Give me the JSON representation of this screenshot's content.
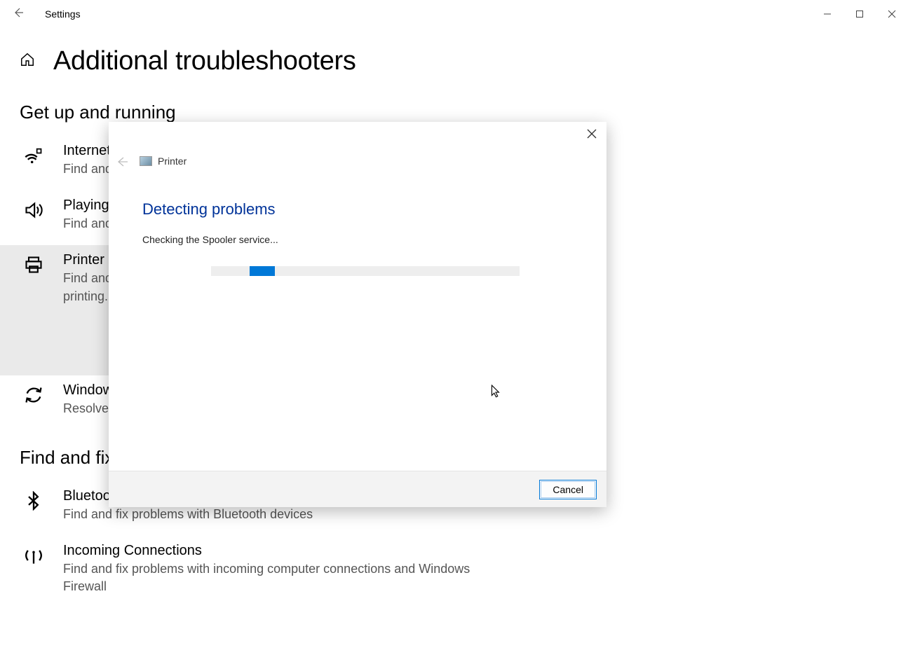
{
  "window": {
    "app_title": "Settings"
  },
  "page": {
    "title": "Additional troubleshooters"
  },
  "sections": {
    "getup": {
      "heading": "Get up and running",
      "items": [
        {
          "title": "Internet",
          "desc": "Find and fix problems with connecting to the Internet or to websites."
        },
        {
          "title": "Playing Audio",
          "desc": "Find and fix problems with playing sound."
        },
        {
          "title": "Printer",
          "desc": "Find and fix problems with printing."
        },
        {
          "title": "Windows Update",
          "desc": "Resolve problems that prevent you from updating Windows."
        }
      ]
    },
    "other": {
      "heading": "Find and fix other problems",
      "items": [
        {
          "title": "Bluetooth",
          "desc": "Find and fix problems with Bluetooth devices"
        },
        {
          "title": "Incoming Connections",
          "desc": "Find and fix problems with incoming computer connections and Windows Firewall"
        }
      ]
    }
  },
  "dialog": {
    "breadcrumb": "Printer",
    "title": "Detecting problems",
    "status": "Checking the Spooler service...",
    "cancel": "Cancel"
  }
}
